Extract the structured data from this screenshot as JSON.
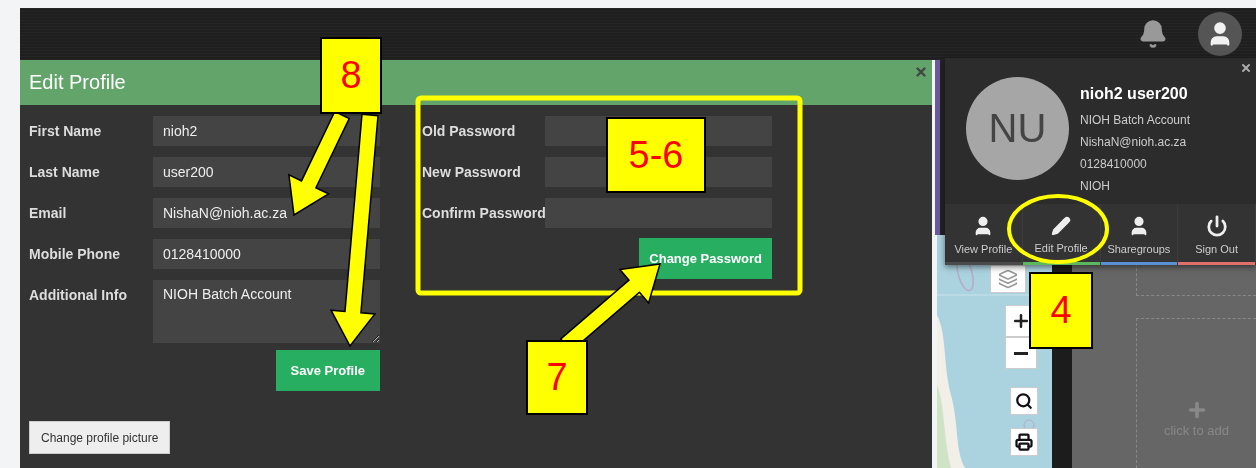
{
  "dialog": {
    "title": "Edit Profile",
    "profile_fields": [
      {
        "label": "First Name",
        "value": "nioh2",
        "kind": "input"
      },
      {
        "label": "Last Name",
        "value": "user200",
        "kind": "input"
      },
      {
        "label": "Email",
        "value": "NishaN@nioh.ac.za",
        "kind": "input"
      },
      {
        "label": "Mobile Phone",
        "value": "0128410000",
        "kind": "input"
      },
      {
        "label": "Additional Info",
        "value": "NIOH Batch Account",
        "kind": "textarea"
      }
    ],
    "save_button": "Save Profile",
    "password_fields": [
      {
        "label": "Old Password"
      },
      {
        "label": "New Password"
      },
      {
        "label": "Confirm Password"
      }
    ],
    "change_password_button": "Change Password",
    "picture_button": "Change profile picture"
  },
  "profile_popup": {
    "initials": "NU",
    "name": "nioh2 user200",
    "details": [
      "NIOH Batch Account",
      "NishaN@nioh.ac.za",
      "0128410000",
      "NIOH"
    ],
    "menu": [
      {
        "label": "View Profile",
        "kind": "user",
        "color": "#4a4a4a"
      },
      {
        "label": "Edit Profile",
        "kind": "edit",
        "color": "#5cb85c"
      },
      {
        "label": "Sharegroups",
        "kind": "user",
        "color": "#5b8fd6"
      },
      {
        "label": "Sign Out",
        "kind": "power",
        "color": "#e0706a"
      }
    ]
  },
  "add_panel": {
    "hint": "click to add"
  },
  "callouts": [
    {
      "label": "8"
    },
    {
      "label": "5-6"
    },
    {
      "label": "7"
    },
    {
      "label": "4"
    }
  ]
}
